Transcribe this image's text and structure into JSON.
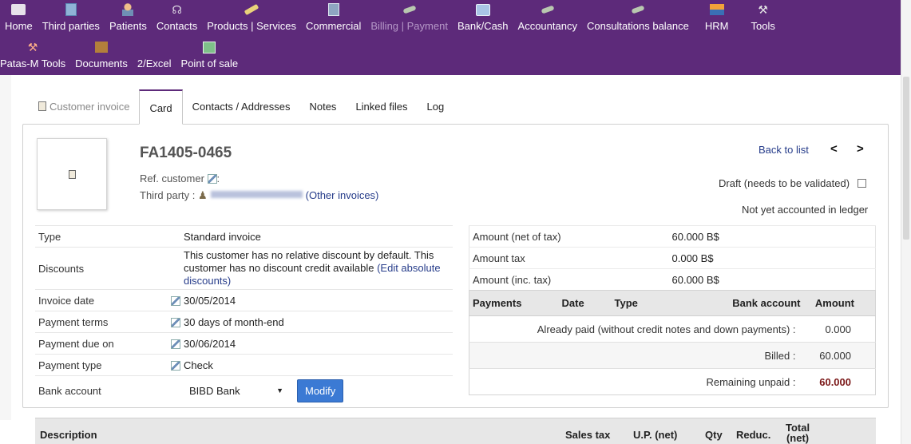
{
  "menu": {
    "row1": [
      {
        "label": "Home",
        "icon": "home-icon",
        "disabled": false
      },
      {
        "label": "Third parties",
        "icon": "building-icon",
        "disabled": false
      },
      {
        "label": "Patients",
        "icon": "patient-icon",
        "disabled": false
      },
      {
        "label": "Contacts",
        "icon": "stethoscope-icon",
        "disabled": false
      },
      {
        "label": "Products | Services",
        "icon": "pen-icon",
        "disabled": false
      },
      {
        "label": "Commercial",
        "icon": "commercial-icon",
        "disabled": false
      },
      {
        "label": "Billing | Payment",
        "icon": "billing-icon",
        "disabled": true
      },
      {
        "label": "Bank/Cash",
        "icon": "bank-icon",
        "disabled": false
      },
      {
        "label": "Accountancy",
        "icon": "accountancy-icon",
        "disabled": false
      },
      {
        "label": "Consultations balance",
        "icon": "consultations-icon",
        "disabled": false
      },
      {
        "label": "HRM",
        "icon": "hrm-icon",
        "disabled": false
      },
      {
        "label": "Tools",
        "icon": "tools-icon",
        "disabled": false
      }
    ],
    "row2": [
      {
        "label": "Patas-M Tools",
        "icon": "patas-tools-icon"
      },
      {
        "label": "Documents",
        "icon": "documents-icon"
      },
      {
        "label": "2/Excel",
        "icon": "excel-icon"
      },
      {
        "label": "Point of sale",
        "icon": "point-of-sale-icon"
      }
    ]
  },
  "tabs": {
    "title": "Customer invoice",
    "items": [
      "Card",
      "Contacts / Addresses",
      "Notes",
      "Linked files",
      "Log"
    ],
    "active": "Card"
  },
  "invoice": {
    "ref": "FA1405-0465",
    "ref_customer_label": "Ref. customer",
    "ref_customer_suffix": ":",
    "third_party_label": "Third party :",
    "other_invoices": "(Other invoices)",
    "back_to_list": "Back to list",
    "prev": "<",
    "next": ">",
    "draft_label": "Draft (needs to be validated)",
    "accounting_status": "Not yet accounted in ledger"
  },
  "details": {
    "type_label": "Type",
    "type_value": "Standard invoice",
    "discounts_label": "Discounts",
    "discounts_text": "This customer has no relative discount by default. This customer has no discount credit available",
    "discounts_link": "(Edit absolute discounts)",
    "invoice_date_label": "Invoice date",
    "invoice_date_value": "30/05/2014",
    "payment_terms_label": "Payment terms",
    "payment_terms_value": "30 days of month-end",
    "payment_due_label": "Payment due on",
    "payment_due_value": "30/06/2014",
    "payment_type_label": "Payment type",
    "payment_type_value": "Check",
    "bank_account_label": "Bank account",
    "bank_account_value": "BIBD Bank",
    "modify_label": "Modify"
  },
  "amounts": {
    "net_label": "Amount (net of tax)",
    "net_value": "60.000 B$",
    "tax_label": "Amount tax",
    "tax_value": "0.000 B$",
    "inc_label": "Amount (inc. tax)",
    "inc_value": "60.000 B$"
  },
  "payments": {
    "headers": [
      "Payments",
      "Date",
      "Type",
      "Bank account",
      "Amount"
    ],
    "already_paid_label": "Already paid (without credit notes and down payments) :",
    "already_paid_value": "0.000",
    "billed_label": "Billed :",
    "billed_value": "60.000",
    "remaining_label": "Remaining unpaid :",
    "remaining_value": "60.000"
  },
  "lines": {
    "headers": {
      "description": "Description",
      "sales_tax": "Sales tax",
      "up_net": "U.P. (net)",
      "qty": "Qty",
      "reduc": "Reduc.",
      "total_net_1": "Total",
      "total_net_2": "(net)"
    }
  },
  "colors": {
    "menu_bg": "#5d2a7a",
    "link": "#263c8a",
    "button": "#3b7ad4",
    "due": "#7a1717"
  }
}
